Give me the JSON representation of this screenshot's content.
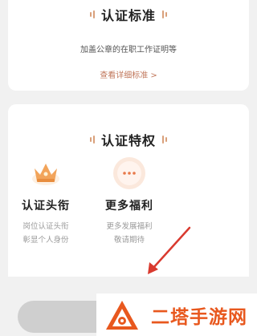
{
  "standard": {
    "title": "认证标准",
    "description": "加盖公章的在职工作证明等",
    "detail_link": "查看详细标准 >"
  },
  "privileges": {
    "title": "认证特权",
    "items": [
      {
        "name": "认证头衔",
        "line1": "岗位认证头衔",
        "line2": "彰显个人身份",
        "icon": "crown-icon"
      },
      {
        "name": "更多福利",
        "line1": "更多发展福利",
        "line2": "敬请期待",
        "icon": "more-dots-icon"
      }
    ]
  },
  "watermark": {
    "text": "二塔手游网",
    "icon": "triangle-logo-icon"
  },
  "colors": {
    "accent": "#c0765a",
    "watermark": "#e8581e",
    "arrow": "#d93a2f",
    "button": "#cfcfcf"
  }
}
